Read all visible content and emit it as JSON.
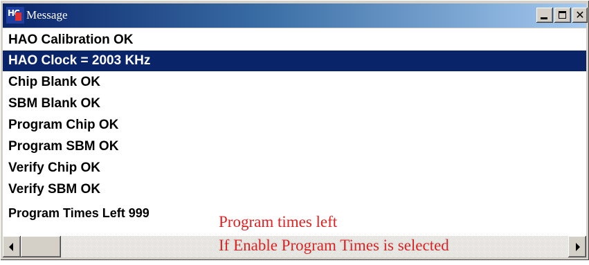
{
  "window": {
    "title": "Message",
    "icon": "app-logo-icon",
    "controls": [
      "minimize-icon",
      "maximize-icon",
      "close-icon"
    ],
    "colors": {
      "title_active": "#0a246a",
      "selection": "#0a246a",
      "annotation": "#e02020",
      "face": "#d4d0c8"
    }
  },
  "messages": [
    {
      "text": "HAO Calibration OK",
      "selected": false
    },
    {
      "text": "HAO Clock = 2003 KHz",
      "selected": true
    },
    {
      "text": "Chip Blank OK",
      "selected": false
    },
    {
      "text": "SBM Blank OK",
      "selected": false
    },
    {
      "text": "Program Chip OK",
      "selected": false
    },
    {
      "text": "Program SBM OK",
      "selected": false
    },
    {
      "text": "Verify Chip OK",
      "selected": false
    },
    {
      "text": "Verify SBM OK",
      "selected": false
    },
    {
      "text": "Program Times Left 999",
      "selected": false
    }
  ],
  "annotations": {
    "line1": "Program times left",
    "line2": "If Enable Program Times is selected"
  }
}
